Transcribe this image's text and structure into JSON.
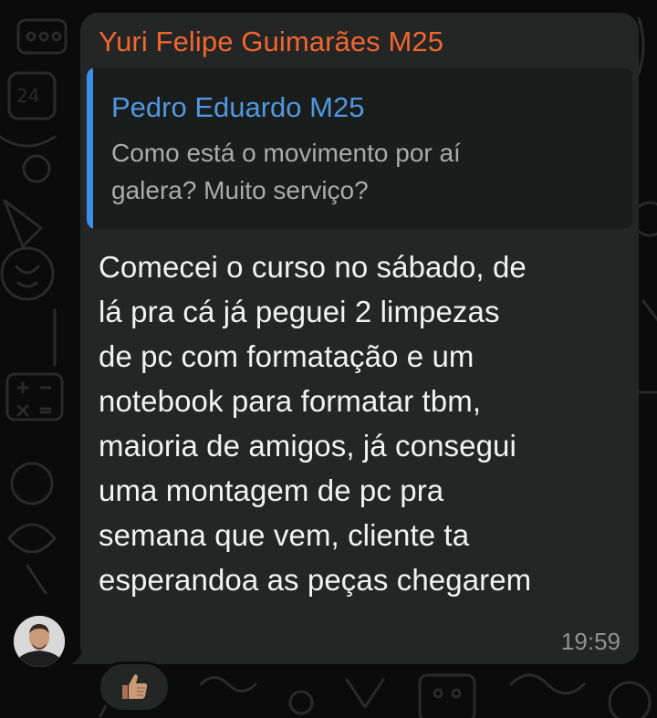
{
  "chat": {
    "message": {
      "sender": "Yuri Felipe Guimarães M25",
      "reply": {
        "author": "Pedro Eduardo M25",
        "text": "Como está o movimento por aí\ngalera? Muito serviço?"
      },
      "text": "Comecei o curso no sábado, de\nlá pra cá já peguei 2 limpezas\nde pc com formatação e um\nnotebook para formatar tbm,\nmaioria de amigos, já consegui\numa montagem de pc pra\nsemana que vem, cliente ta\nesperandoa as peças chegarem",
      "time": "19:59",
      "reaction": "thumbs-up-medium-skin-icon",
      "avatar": "sender-avatar-photo"
    }
  },
  "colors": {
    "background": "#0b0b0b",
    "bubble": "#242626",
    "quote_background": "#1b1c1c",
    "sender_name": "#f0662f",
    "quote_author": "#4f98e0",
    "quote_bar": "#3b8fe6",
    "message_text": "#f2f2f2",
    "quote_text": "#a9abac",
    "timestamp": "#8e9091"
  }
}
